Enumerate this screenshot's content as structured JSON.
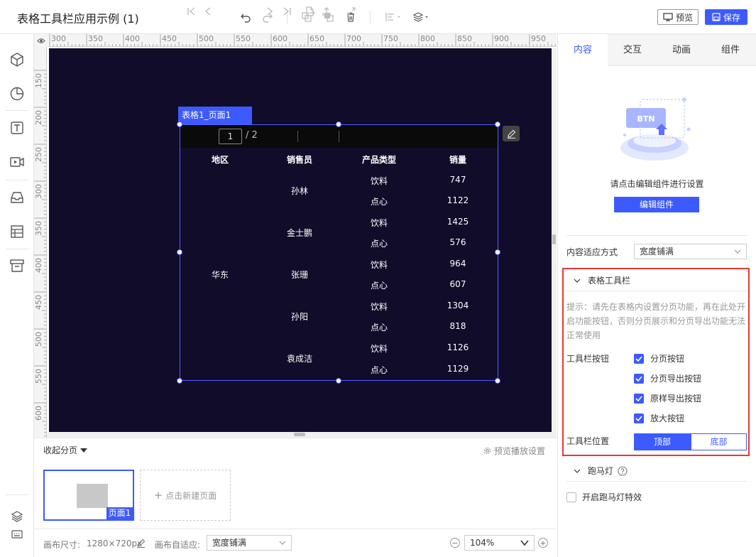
{
  "app": {
    "title": "表格工具栏应用示例 (1)",
    "preview_label": "预览",
    "save_label": "保存"
  },
  "ruler": {
    "h_ticks": [
      "300",
      "350",
      "400",
      "450",
      "500",
      "550",
      "600",
      "650",
      "700",
      "750",
      "800",
      "850",
      "900",
      "950"
    ],
    "v_ticks": [
      "150",
      "200",
      "250",
      "300",
      "350",
      "400",
      "450",
      "500",
      "550",
      "600"
    ]
  },
  "component": {
    "tag": "表格1_页面1",
    "toolbar": {
      "current_page": "1",
      "total_pages": "/ 2"
    },
    "table": {
      "headers": [
        "地区",
        "销售员",
        "产品类型",
        "销量"
      ],
      "region": "华东",
      "salespeople": [
        "孙林",
        "金士鹏",
        "张珊",
        "孙阳",
        "袁成洁"
      ],
      "rows": [
        {
          "type": "饮料",
          "qty": "747"
        },
        {
          "type": "点心",
          "qty": "1122"
        },
        {
          "type": "饮料",
          "qty": "1425"
        },
        {
          "type": "点心",
          "qty": "576"
        },
        {
          "type": "饮料",
          "qty": "964"
        },
        {
          "type": "点心",
          "qty": "607"
        },
        {
          "type": "饮料",
          "qty": "1304"
        },
        {
          "type": "点心",
          "qty": "818"
        },
        {
          "type": "饮料",
          "qty": "1126"
        },
        {
          "type": "点心",
          "qty": "1129"
        }
      ]
    }
  },
  "pages": {
    "collapse_label": "收起分页",
    "preview_settings": "预览播放设置",
    "page1_label": "页面1",
    "new_page_label": "点击新建页面"
  },
  "status": {
    "canvas_size_label": "画布尺寸:",
    "canvas_size": "1280×720px",
    "canvas_fit_label": "画布自适应:",
    "canvas_fit_value": "宽度铺满",
    "zoom": "104%"
  },
  "panel": {
    "tabs": [
      "内容",
      "交互",
      "动画",
      "组件"
    ],
    "illustration_text": "BTN",
    "hint": "请点击编辑组件进行设置",
    "edit_button": "编辑组件",
    "fit_label": "内容适应方式",
    "fit_value": "宽度铺满",
    "toolbar_section": {
      "title": "表格工具栏",
      "tip": "提示：请先在表格内设置分页功能，再在此处开启功能按钮，否则分页展示和分页导出功能无法正常使用",
      "buttons_label": "工具栏按钮",
      "buttons": [
        {
          "label": "分页按钮",
          "checked": true
        },
        {
          "label": "分页导出按钮",
          "checked": true
        },
        {
          "label": "原样导出按钮",
          "checked": true
        },
        {
          "label": "放大按钮",
          "checked": true
        }
      ],
      "position_label": "工具栏位置",
      "position_options": [
        "顶部",
        "底部"
      ],
      "position_selected": "顶部"
    },
    "marquee_section": {
      "title": "跑马灯",
      "enable_label": "开启跑马灯特效",
      "enabled": false
    }
  },
  "colors": {
    "accent": "#3d5afe",
    "canvas_bg": "#100c2a",
    "highlight_border": "#e53935"
  }
}
